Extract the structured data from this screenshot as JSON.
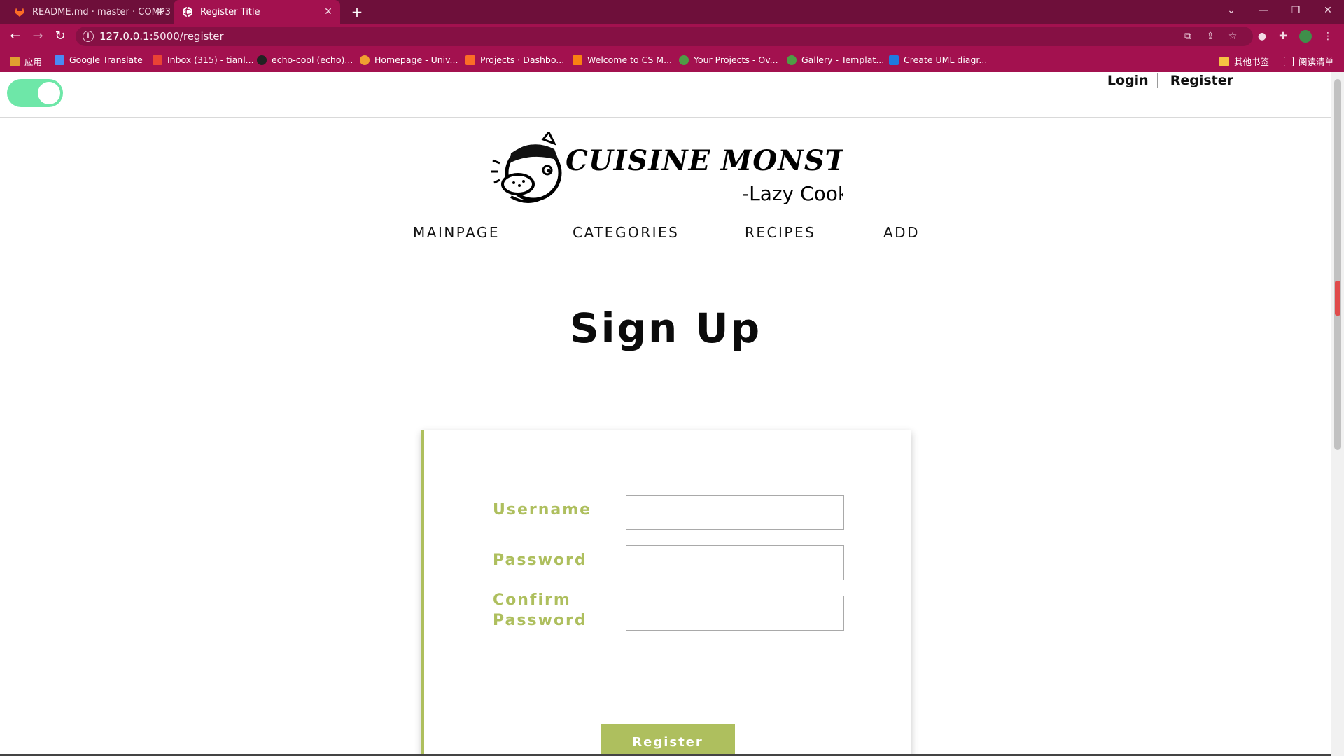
{
  "browser": {
    "tabs": [
      {
        "title": "README.md · master · COMP3",
        "icon": "gitlab-icon",
        "active": false
      },
      {
        "title": "Register Title",
        "icon": "globe-icon",
        "active": true
      }
    ],
    "address": {
      "host": "127.0.0.1",
      "path": ":5000/register"
    },
    "bookmarks": [
      {
        "label": "应用",
        "icon": "apps-grid-icon",
        "color": "#e0a030"
      },
      {
        "label": "Google Translate",
        "icon": "google-translate-icon",
        "color": "#4a8af4"
      },
      {
        "label": "Inbox (315) - tianl...",
        "icon": "gmail-icon",
        "color": "#ea4335"
      },
      {
        "label": "echo-cool (echo)...",
        "icon": "github-icon",
        "color": "#222222"
      },
      {
        "label": "Homepage - Univ...",
        "icon": "bitbucket-icon",
        "color": "#f0a030"
      },
      {
        "label": "Projects · Dashbo...",
        "icon": "gitlab-icon",
        "color": "#fc6d26"
      },
      {
        "label": "Welcome to CS M...",
        "icon": "moodle-icon",
        "color": "#f98012"
      },
      {
        "label": "Your Projects - Ov...",
        "icon": "overleaf-icon",
        "color": "#4f9c45"
      },
      {
        "label": "Gallery - Templat...",
        "icon": "overleaf-icon",
        "color": "#4f9c45"
      },
      {
        "label": "Create UML diagr...",
        "icon": "yuml-icon",
        "color": "#1f7ae0"
      }
    ],
    "bookmarks_right": [
      {
        "label": "其他书签",
        "icon": "folder-icon"
      },
      {
        "label": "阅读清单",
        "icon": "reading-list-icon"
      }
    ]
  },
  "header": {
    "login": "Login",
    "register": "Register",
    "toggle_on": true
  },
  "logo": {
    "name": "CUISINE MONSTER",
    "tagline": "-Lazy Cook"
  },
  "nav": [
    "MAINPAGE",
    "CATEGORIES",
    "RECIPES",
    "ADD"
  ],
  "page_title": "Sign Up",
  "form": {
    "username_label": "Username",
    "password_label": "Password",
    "confirm_label_1": "Confirm",
    "confirm_label_2": "Password",
    "username_value": "",
    "password_value": "",
    "confirm_value": "",
    "submit_label": "Register"
  },
  "colors": {
    "chrome": "#6e0f3a",
    "accent": "#a3114f",
    "form_green": "#aebf5e",
    "toggle_green": "#6ee7a8"
  }
}
